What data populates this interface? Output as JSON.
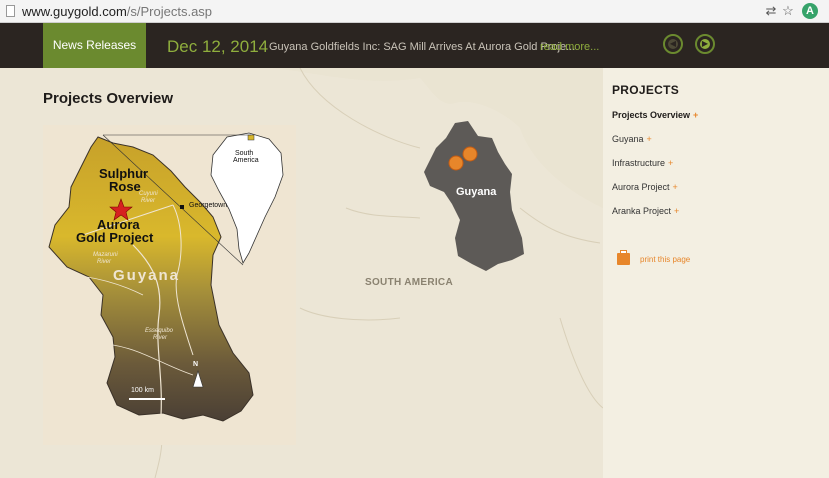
{
  "browser": {
    "url_host": "www.guygold.com",
    "url_path": "/s/Projects.asp",
    "ext_icon": "A"
  },
  "news": {
    "tab_label": "News Releases",
    "date": "Dec 12, 2014",
    "headline": "Guyana Goldfields Inc: SAG Mill Arrives At Aurora Gold Proje...",
    "more": "read more...",
    "prev_icon": "arrow-left-icon",
    "next_icon": "arrow-right-icon"
  },
  "main": {
    "title": "Projects Overview",
    "map_label_sa": "SOUTH AMERICA",
    "map_label_guyana": "Guyana"
  },
  "inset": {
    "label_sulphur": "Sulphur",
    "label_rose": "Rose",
    "label_aurora1": "Aurora",
    "label_aurora2": "Gold Project",
    "label_georgetown": "Georgetown",
    "label_guyana": "Guyana",
    "label_cuyuni": "Cuyuni",
    "label_cuyuni2": "River",
    "label_mazaruni": "Mazaruni",
    "label_mazaruni2": "River",
    "label_essequibo": "Essequibo",
    "label_essequibo2": "River",
    "label_south": "South",
    "label_america": "America",
    "scale": "100 km",
    "north": "N"
  },
  "sidebar": {
    "title": "PROJECTS",
    "items": [
      {
        "label": "Projects Overview",
        "plus": "+"
      },
      {
        "label": "Guyana",
        "plus": "+"
      },
      {
        "label": "Infrastructure",
        "plus": "+"
      },
      {
        "label": "Aurora Project",
        "plus": "+"
      },
      {
        "label": "Aranka Project",
        "plus": "+"
      }
    ],
    "print_label": "print this page"
  },
  "colors": {
    "accent_green": "#6b8a2f",
    "accent_orange": "#e7862a",
    "header_bg": "#2b2521"
  }
}
